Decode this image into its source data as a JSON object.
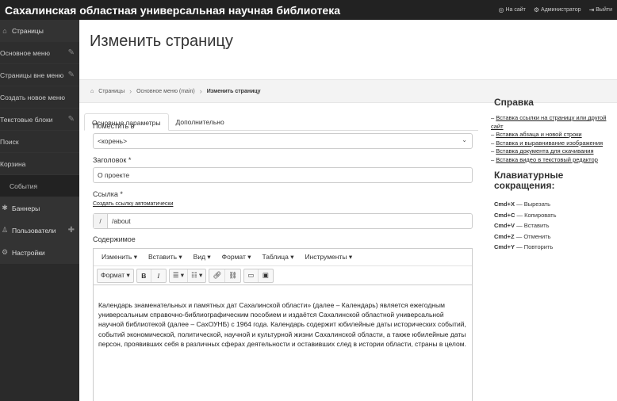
{
  "app": {
    "brand": "Сахалинская областная универсальная научная библиотека",
    "top_links": {
      "site": "На сайт",
      "admin": "Администратор",
      "logout": "Выйти"
    }
  },
  "sidebar": {
    "items": [
      {
        "label": "Страницы",
        "icon": "home-icon"
      },
      {
        "label": "Основное меню"
      },
      {
        "label": "Страницы вне меню"
      },
      {
        "label": "Создать новое меню"
      },
      {
        "label": "Текстовые блоки"
      },
      {
        "label": "Поиск"
      },
      {
        "label": "Корзина"
      },
      {
        "label": "События"
      },
      {
        "label": "Баннеры",
        "icon": "star-icon"
      },
      {
        "label": "Пользователи",
        "icon": "users-icon"
      },
      {
        "label": "Настройки",
        "icon": "gear-icon"
      }
    ]
  },
  "page": {
    "title": "Изменить страницу",
    "breadcrumb": [
      "Страницы",
      "Основное меню (main)",
      "Изменить страницу"
    ]
  },
  "tabs": [
    "Основные параметры",
    "Дополнительно"
  ],
  "form": {
    "place_label": "Поместить в",
    "place_value": "<корень>",
    "title_label": "Заголовок *",
    "title_value": "О проекте",
    "link_label": "Ссылка *",
    "auto_link": "Создать ссылку автоматически",
    "link_prefix": "/",
    "link_value": "/about",
    "content_label": "Содержимое"
  },
  "editor": {
    "menu": [
      "Изменить ▾",
      "Вставить ▾",
      "Вид ▾",
      "Формат ▾",
      "Таблица ▾",
      "Инструменты ▾"
    ],
    "format_button": "Формат ▾",
    "bold": "B",
    "italic": "I",
    "content": "Календарь знаменательных и памятных дат Сахалинской области» (далее – Календарь) является ежегодным универсальным справочно-библиографическим пособием и издаётся Сахалинской областной универсальной научной библиотекой (далее – СахОУНБ) с 1964 года. Календарь содержит юбилейные даты исторических событий, событий экономической, политической, научной и культурной жизни Сахалинской области, а также юбилейные даты персон, проявивших себя в различных сферах деятельности и оставивших след в истории области, страны в целом."
  },
  "help": {
    "title": "Справка",
    "links": [
      "Вставка ссылки на страницу или другой сайт",
      "Вставка абзаца и новой строки",
      "Вставка и выравнивание изображения",
      "Вставка документа для скачивания",
      "Вставка видео в текстовый редактор"
    ],
    "shortcuts_title": "Клавиатурные сокращения:",
    "shortcuts": [
      {
        "key": "Cmd+X",
        "action": "Вырезать"
      },
      {
        "key": "Cmd+C",
        "action": "Копировать"
      },
      {
        "key": "Cmd+V",
        "action": "Вставить"
      },
      {
        "key": "Cmd+Z",
        "action": "Отменить"
      },
      {
        "key": "Cmd+Y",
        "action": "Повторить"
      }
    ]
  }
}
